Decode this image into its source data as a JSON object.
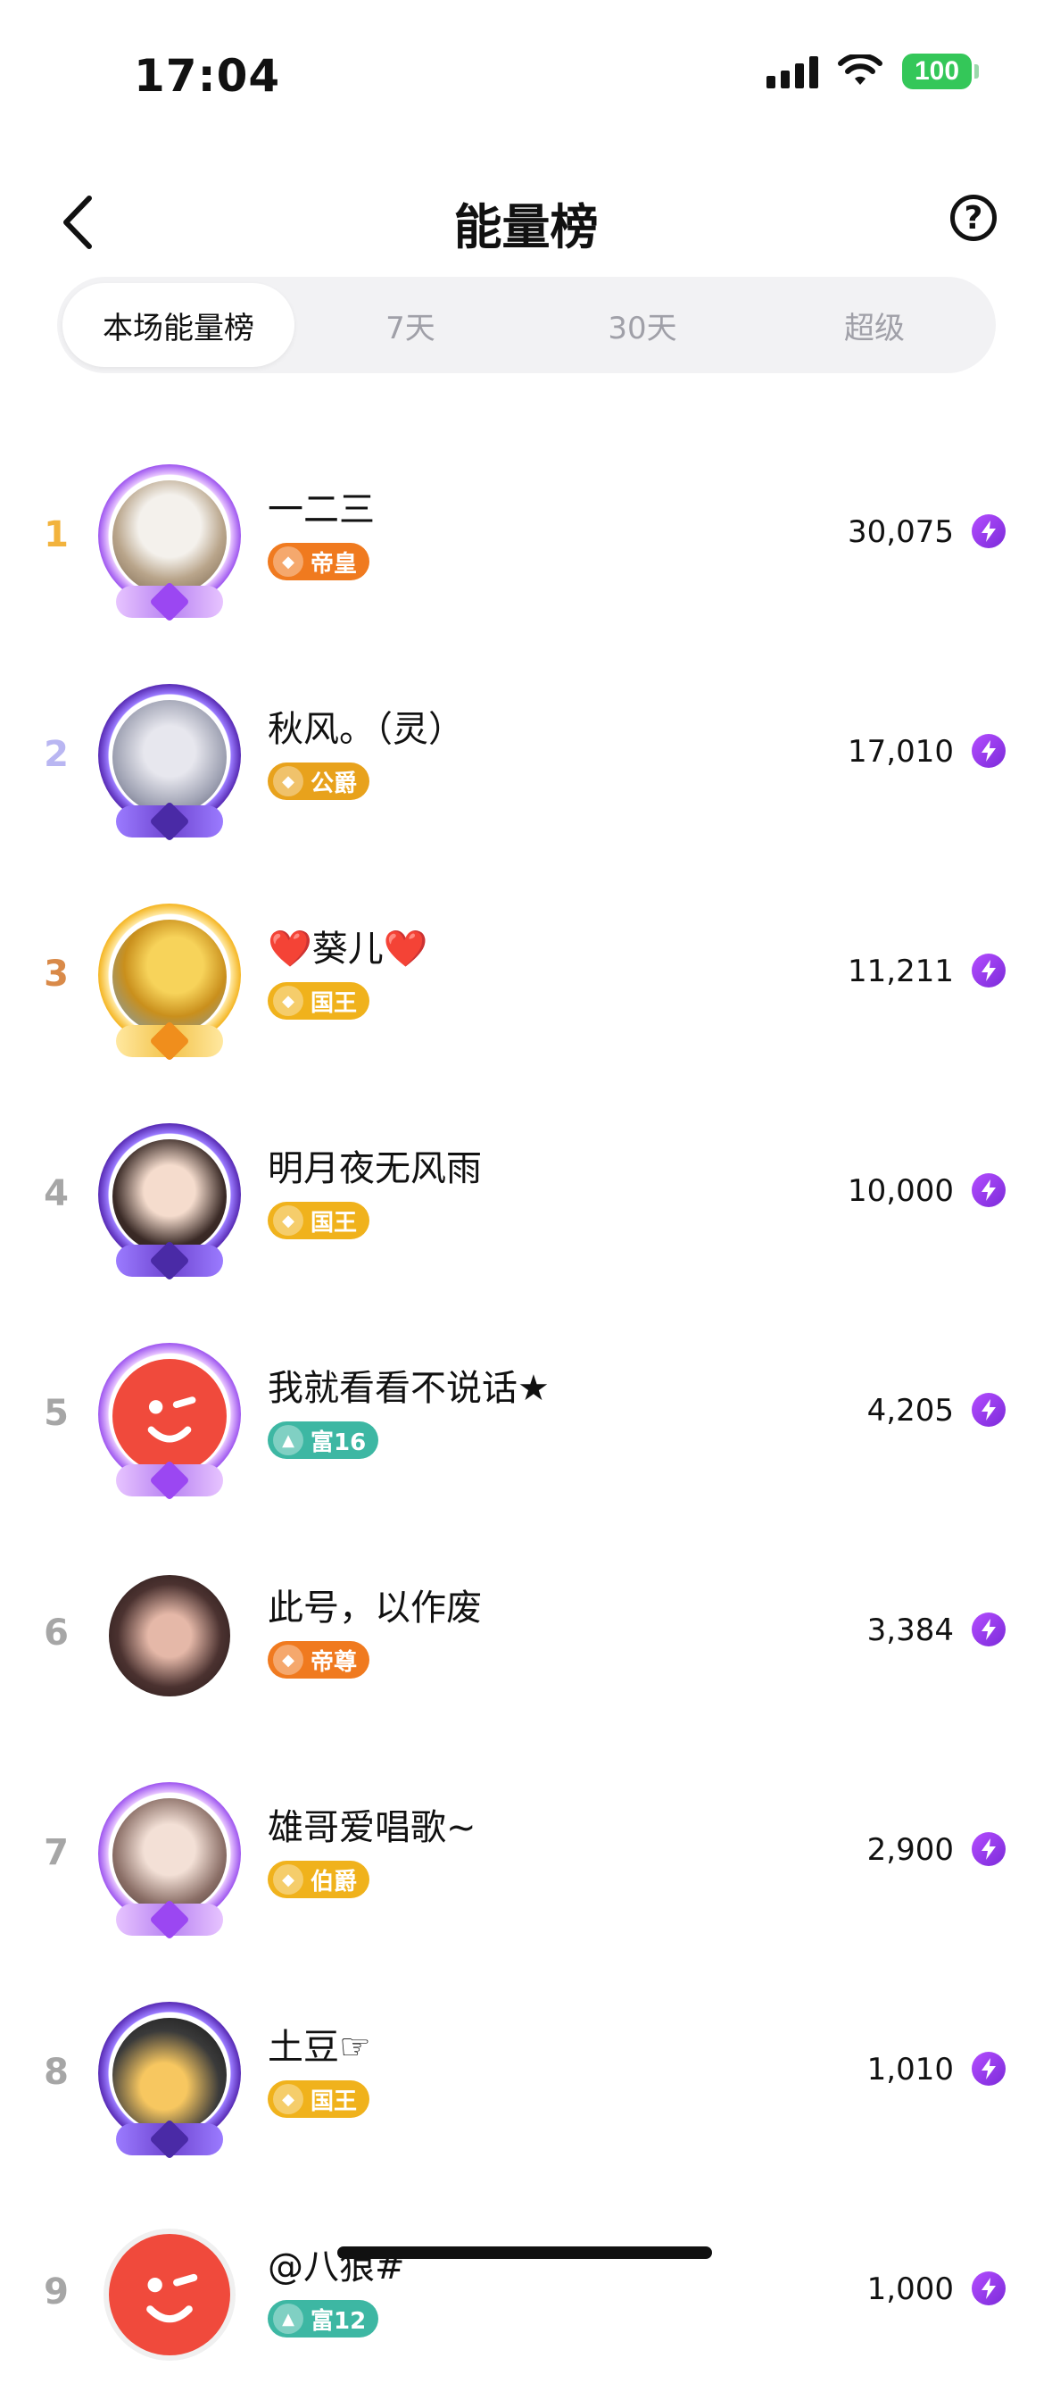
{
  "status": {
    "time": "17:04",
    "battery": "100"
  },
  "header": {
    "title": "能量榜",
    "help": "?"
  },
  "tabs": [
    {
      "label": "本场能量榜",
      "active": true
    },
    {
      "label": "7天",
      "active": false
    },
    {
      "label": "30天",
      "active": false
    },
    {
      "label": "超级",
      "active": false
    }
  ],
  "rows": [
    {
      "rank": "1",
      "rank_color": "#f2b33d",
      "name": "一二三",
      "badge": "帝皇",
      "badge_color": "#f07a1f",
      "score": "30,075",
      "frame": "purple",
      "avatar": "photo-white"
    },
    {
      "rank": "2",
      "rank_color": "#b9b6f2",
      "name": "秋风。（灵）",
      "badge": "公爵",
      "badge_color": "#e8a21c",
      "score": "17,010",
      "frame": "purple-crown",
      "avatar": "photo-grey"
    },
    {
      "rank": "3",
      "rank_color": "#d98a49",
      "name": "❤️葵儿❤️",
      "badge": "国王",
      "badge_color": "#f0b21c",
      "score": "11,211",
      "frame": "gold",
      "avatar": "photo-yellow"
    },
    {
      "rank": "4",
      "rank_color": "#a6a6a6",
      "name": "明月夜无风雨",
      "badge": "国王",
      "badge_color": "#f0b21c",
      "score": "10,000",
      "frame": "purple-crown",
      "avatar": "photo-girl"
    },
    {
      "rank": "5",
      "rank_color": "#a6a6a6",
      "name": "我就看看不说话★",
      "badge": "富16",
      "badge_color": "#3db7a3",
      "score": "4,205",
      "frame": "purple",
      "avatar": "red-face"
    },
    {
      "rank": "6",
      "rank_color": "#a6a6a6",
      "name": "此号，以作废",
      "badge": "帝尊",
      "badge_color": "#f07a1f",
      "score": "3,384",
      "frame": "none",
      "avatar": "photo-dark"
    },
    {
      "rank": "7",
      "rank_color": "#a6a6a6",
      "name": "雄哥爱唱歌~",
      "badge": "伯爵",
      "badge_color": "#f0b21c",
      "score": "2,900",
      "frame": "purple",
      "avatar": "photo-girl2"
    },
    {
      "rank": "8",
      "rank_color": "#a6a6a6",
      "name": "土豆☞",
      "badge": "国王",
      "badge_color": "#f0b21c",
      "score": "1,010",
      "frame": "purple-crown",
      "avatar": "photo-silhouette"
    },
    {
      "rank": "9",
      "rank_color": "#a6a6a6",
      "name": "@八狼#",
      "badge": "富12",
      "badge_color": "#3db7a3",
      "score": "1,000",
      "frame": "none-grey",
      "avatar": "red-face"
    }
  ]
}
